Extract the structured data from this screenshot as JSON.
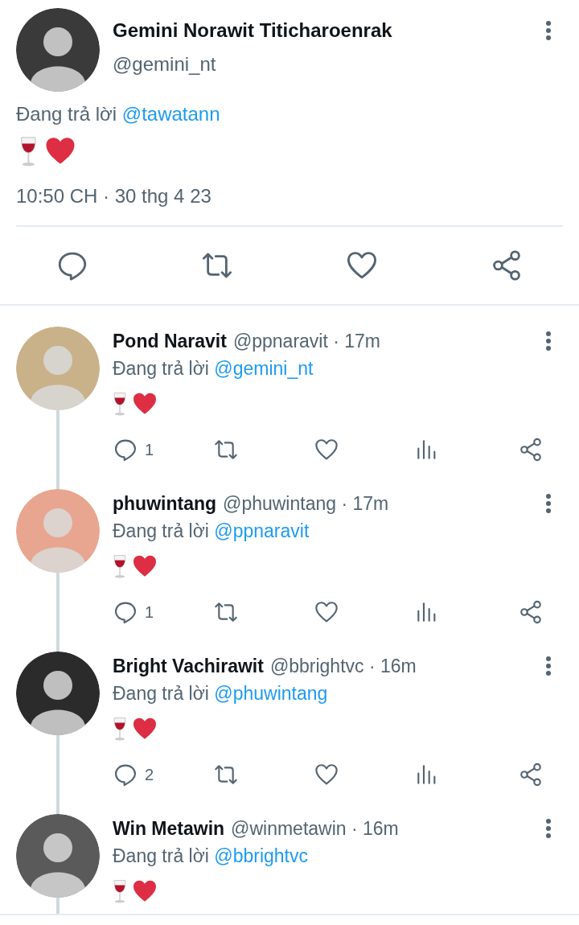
{
  "tweet": {
    "name": "Gemini Norawit Titicharoenrak",
    "handle": "@gemini_nt",
    "reply_prefix": "Đang trả lời",
    "reply_to": "@tawatann",
    "timestamp": "10:50 CH · 30 thg 4 23"
  },
  "replies": [
    {
      "name": "Pond Naravit",
      "meta": "@ppnaravit · 17m",
      "reply_prefix": "Đang trả lời",
      "reply_to": "@gemini_nt",
      "actions": {
        "reply_count": "1"
      }
    },
    {
      "name": "phuwintang",
      "meta": "@phuwintang · 17m",
      "reply_prefix": "Đang trả lời",
      "reply_to": "@ppnaravit",
      "actions": {
        "reply_count": "1"
      }
    },
    {
      "name": "Bright Vachirawit",
      "meta": "@bbrightvc · 16m",
      "reply_prefix": "Đang trả lời",
      "reply_to": "@phuwintang",
      "actions": {
        "reply_count": "2"
      }
    },
    {
      "name": "Win Metawin",
      "meta": "@winmetawin · 16m",
      "reply_prefix": "Đang trả lời",
      "reply_to": "@bbrightvc"
    }
  ]
}
